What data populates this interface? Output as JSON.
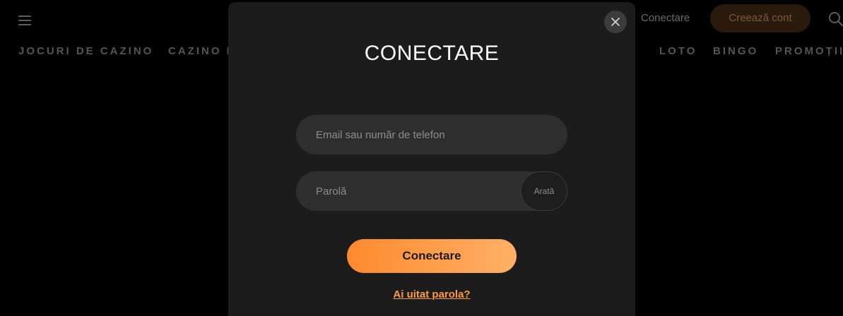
{
  "header": {
    "login_link": "Conectare",
    "signup_button": "Creează cont",
    "icons": {
      "menu": "hamburger-menu-icon",
      "search": "search-icon"
    }
  },
  "nav": {
    "items": [
      "JOCURI DE CAZINO",
      "CAZINO L",
      "LOTO",
      "BINGO",
      "PROMOȚII"
    ]
  },
  "modal": {
    "title": "CONECTARE",
    "email_placeholder": "Email sau număr de telefon",
    "password_placeholder": "Parolă",
    "show_password_label": "Arată",
    "submit_label": "Conectare",
    "forgot_password_label": "Ai uitat parola?",
    "close_icon": "close-icon"
  },
  "colors": {
    "accent": "#ff8a2e",
    "accent_light": "#ffb066",
    "link": "#ff9a45",
    "modal_bg": "#1c1c1c",
    "field_bg": "#2e2e2e",
    "page_bg": "#000000"
  }
}
